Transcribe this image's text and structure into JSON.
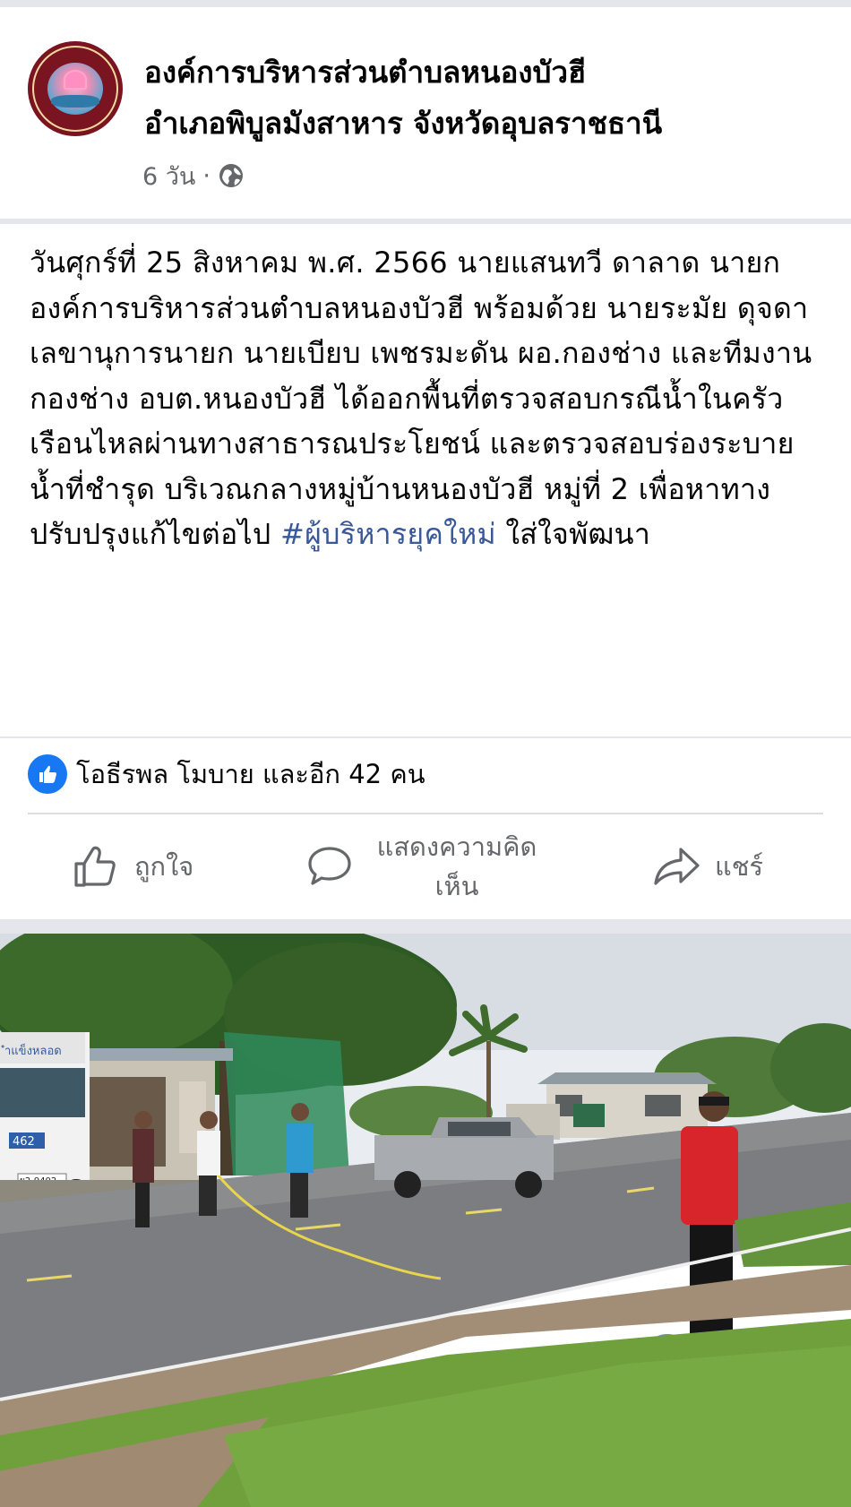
{
  "header": {
    "page_name_line1": "องค์การบริหารส่วนตำบลหนองบัวฮี",
    "page_name_line2": "อำเภอพิบูลมังสาหาร จังหวัดอุบลราชธานี",
    "time": "6 วัน",
    "separator": "·",
    "privacy_icon": "globe-icon"
  },
  "post": {
    "text": "วันศุกร์ที่ 25 สิงหาคม พ.ศ. 2566 นายแสนทวี ดาลาด นายกองค์การบริหารส่วนตำบลหนองบัวฮี พร้อมด้วย นายระมัย ดุจดา เลขานุการนายก นายเบียบ เพชรมะดัน ผอ.กองช่าง และทีมงานกองช่าง อบต.หนองบัวฮี ได้ออกพื้นที่ตรวจสอบกรณีน้ำในครัวเรือนไหลผ่านทางสาธารณประโยชน์ และตรวจสอบร่องระบายน้ำที่ชำรุด บริเวณกลางหมู่บ้านหนองบัวฮี หมู่ที่ 2 เพื่อหาทางปรับปรุงแก้ไขต่อไป ",
    "hashtag": "#ผู้บริหารยุคใหม่",
    "text_after_hashtag": " ใส่ใจพัฒนา"
  },
  "reactions": {
    "icon": "like-badge-icon",
    "text": "โอธีรพล โมบาย และอีก 42 คน"
  },
  "actions": {
    "like_label": "ถูกใจ",
    "comment_label": "แสดงความคิดเห็น",
    "share_label": "แชร์"
  },
  "photo": {
    "truck_label": "462",
    "truck_plate": "ผ2-9402"
  },
  "colors": {
    "link": "#385898",
    "like_blue": "#1877f2",
    "muted": "#65676b",
    "divider": "#e4e6eb"
  }
}
